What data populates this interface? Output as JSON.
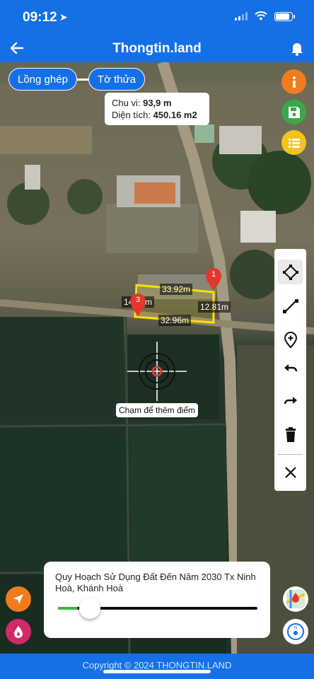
{
  "status": {
    "time": "09:12"
  },
  "header": {
    "title": "Thongtin.land"
  },
  "pills": {
    "overlay": "Lồng ghép",
    "parcel": "Tờ thửa"
  },
  "measure": {
    "perimeter_label": "Chu vi:",
    "perimeter_value": "93,9 m",
    "area_label": "Diện tích:",
    "area_value": "450.16 m2",
    "edges": [
      "33.92m",
      "12.81m",
      "32.96m",
      "14.__m"
    ],
    "marker_1": "1",
    "marker_3": "3"
  },
  "hint": "Chạm để thêm điểm",
  "layer": {
    "title": "Quy Hoạch Sử Dụng Đất Đến Năm 2030 Tx Ninh Hoà, Khánh Hoà",
    "opacity_fraction": 0.1
  },
  "footer": {
    "copyright": "Copyright © 2024 THONGTIN.LAND"
  },
  "colors": {
    "brand_blue": "#1570e6",
    "info_orange": "#f07c1e",
    "save_green": "#3aa84a",
    "list_yellow": "#f1c420",
    "polygon_yellow": "#ffe000",
    "marker_red": "#e2372b"
  },
  "tools": [
    "vertex-edit-icon",
    "line-icon",
    "add-point-icon",
    "undo-icon",
    "redo-icon",
    "trash-icon",
    "close-icon"
  ]
}
